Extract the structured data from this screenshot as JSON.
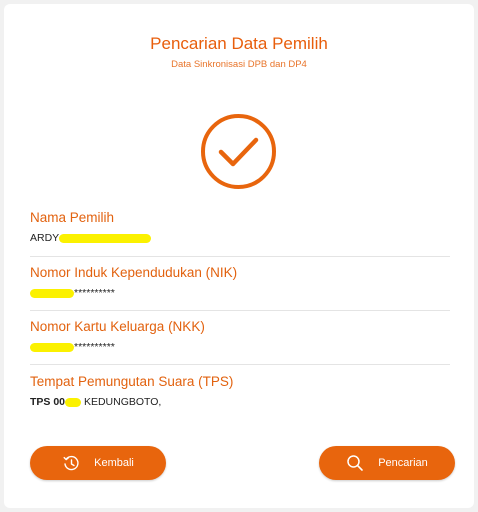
{
  "header": {
    "title": "Pencarian Data Pemilih",
    "subtitle": "Data Sinkronisasi DPB dan DP4"
  },
  "status": {
    "icon": "check-circle-icon",
    "color": "#e8650d"
  },
  "fields": [
    {
      "label": "Nama Pemilih",
      "value_prefix": "ARDY",
      "value_suffix": ""
    },
    {
      "label": "Nomor Induk Kependudukan (NIK)",
      "value_prefix": "",
      "value_suffix": "**********"
    },
    {
      "label": "Nomor Kartu Keluarga (NKK)",
      "value_prefix": "",
      "value_suffix": "**********"
    },
    {
      "label": "Tempat Pemungutan Suara (TPS)",
      "value_prefix": "TPS 00",
      "value_suffix": " KEDUNGBOTO,"
    }
  ],
  "buttons": {
    "back_label": "Kembali",
    "back_icon": "back-clock-icon",
    "search_label": "Pencarian",
    "search_icon": "search-icon"
  },
  "colors": {
    "accent": "#e8650d",
    "highlight": "#fbf100"
  }
}
